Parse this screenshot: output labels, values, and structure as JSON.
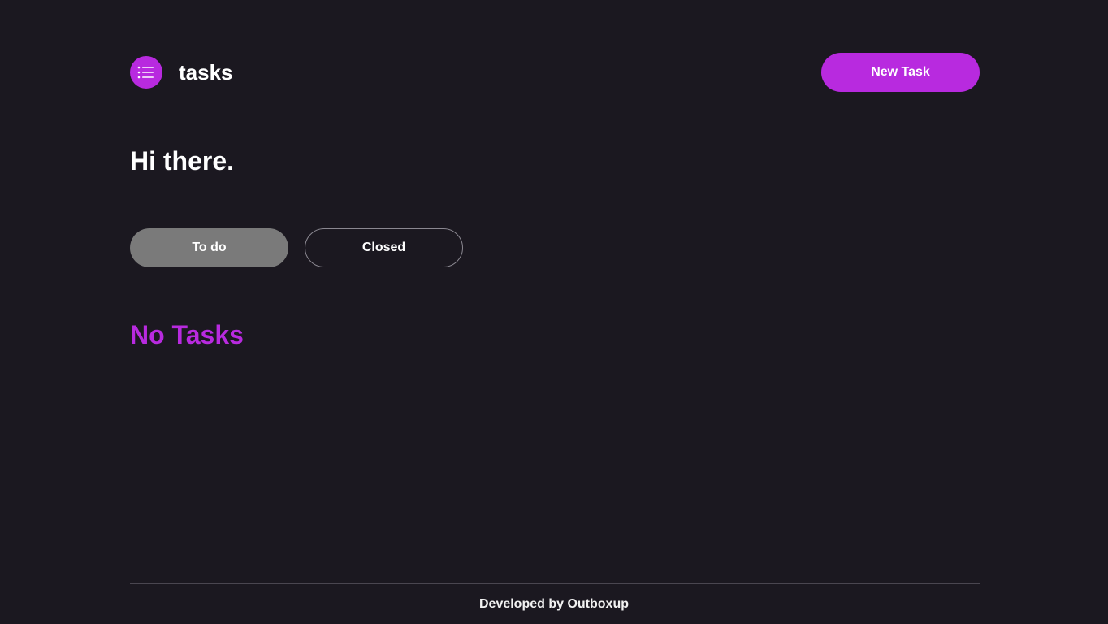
{
  "header": {
    "logo_icon": "list-icon",
    "brand": "tasks",
    "new_task_label": "New Task"
  },
  "main": {
    "greeting": "Hi there.",
    "tabs": [
      {
        "label": "To do",
        "active": true
      },
      {
        "label": "Closed",
        "active": false
      }
    ],
    "empty_state": "No Tasks"
  },
  "footer": {
    "text": "Developed by Outboxup"
  },
  "colors": {
    "background": "#1b1820",
    "accent": "#b82adf",
    "active_tab": "#7a7a7a",
    "text": "#ffffff"
  }
}
